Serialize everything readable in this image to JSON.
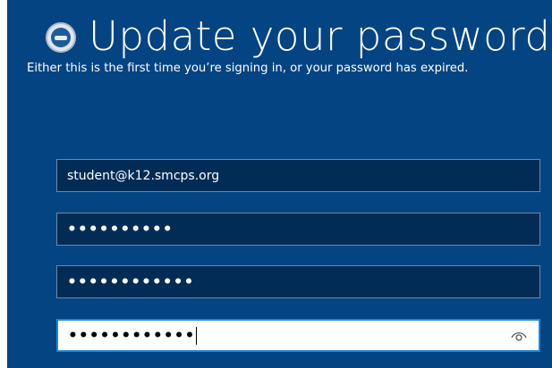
{
  "header": {
    "logo_icon": "school-district-seal-icon",
    "title": "Update your password",
    "subtitle": "Either this is the first time you’re signing in, or your password has expired."
  },
  "form": {
    "username_value": "student@k12.smcps.org",
    "current_password_mask": "••••••••••",
    "new_password_mask": "••••••••••••",
    "confirm_password_mask": "••••••••••••",
    "reveal_icon": "eye-icon"
  },
  "colors": {
    "background": "#054483",
    "field_background": "#002c55",
    "field_border": "#6d88a8",
    "focus_border": "#1a88e0"
  }
}
